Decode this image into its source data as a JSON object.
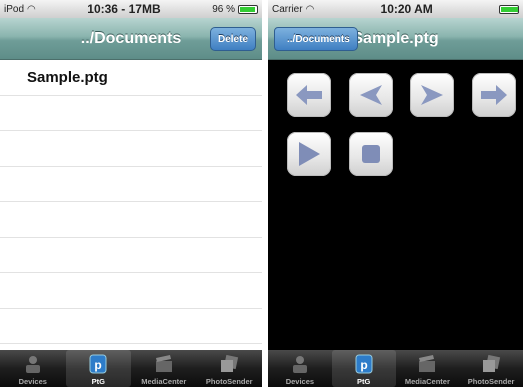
{
  "left": {
    "status": {
      "carrier": "iPod",
      "center": "10:36 - 17MB",
      "battery": "96 %"
    },
    "nav": {
      "title": "../Documents",
      "delete_label": "Delete"
    },
    "files": [
      "Sample.ptg"
    ]
  },
  "right": {
    "status": {
      "carrier": "Carrier",
      "center": "10:20 AM"
    },
    "nav": {
      "title": "Sample.ptg",
      "back_label": "../Documents"
    },
    "controls": [
      "arrow-left-icon",
      "prev-icon",
      "next-icon",
      "arrow-right-icon",
      "play-icon",
      "stop-icon"
    ]
  },
  "tabs": [
    "Devices",
    "PtG",
    "MediaCenter",
    "PhotoSender"
  ],
  "active_tab": "PtG",
  "colors": {
    "accent_blue": "#3f7fc2",
    "nav_teal": "#7ea8a3",
    "control_icon": "#7f8db7"
  }
}
